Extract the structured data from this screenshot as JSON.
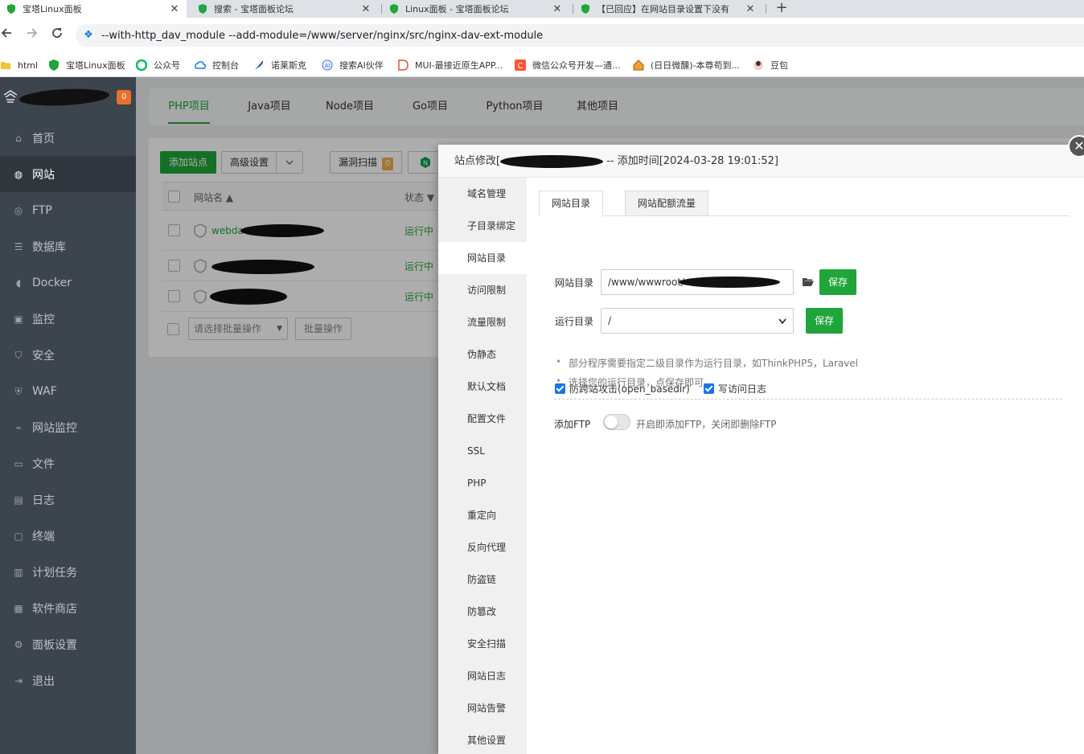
{
  "browser": {
    "tabs": [
      {
        "title": "宝塔Linux面板"
      },
      {
        "title": "搜索 - 宝塔面板论坛"
      },
      {
        "title": "Linux面板 - 宝塔面板论坛"
      },
      {
        "title": "【已回应】在网站目录设置下没有"
      }
    ],
    "close_glyph": "✕",
    "new_tab_glyph": "+",
    "url": "--with-http_dav_module --add-module=/www/server/nginx/src/nginx-dav-ext-module",
    "bookmarks": [
      {
        "label": "html",
        "icon": "folder-icon"
      },
      {
        "label": "宝塔Linux面板",
        "icon": "baota-icon"
      },
      {
        "label": "公众号",
        "icon": "wechat-icon"
      },
      {
        "label": "控制台",
        "icon": "cloud-icon"
      },
      {
        "label": "诺莱斯克",
        "icon": "feather-icon"
      },
      {
        "label": "搜索AI伙伴",
        "icon": "ai-icon"
      },
      {
        "label": "MUI-最接近原生APP...",
        "icon": "mui-icon"
      },
      {
        "label": "微信公众号开发—通...",
        "icon": "csdn-icon"
      },
      {
        "label": "(日日微醺)-本尊苟到...",
        "icon": "house-icon"
      },
      {
        "label": "豆包",
        "icon": "doubao-icon"
      }
    ]
  },
  "sidebar": {
    "version_badge": "0",
    "items": [
      {
        "label": "首页",
        "icon": "home-icon"
      },
      {
        "label": "网站",
        "icon": "globe-icon"
      },
      {
        "label": "FTP",
        "icon": "ftp-icon"
      },
      {
        "label": "数据库",
        "icon": "database-icon"
      },
      {
        "label": "Docker",
        "icon": "docker-icon"
      },
      {
        "label": "监控",
        "icon": "monitor-icon"
      },
      {
        "label": "安全",
        "icon": "shield-icon"
      },
      {
        "label": "WAF",
        "icon": "waf-icon"
      },
      {
        "label": "网站监控",
        "icon": "chart-icon"
      },
      {
        "label": "文件",
        "icon": "folder-icon"
      },
      {
        "label": "日志",
        "icon": "log-icon"
      },
      {
        "label": "终端",
        "icon": "terminal-icon"
      },
      {
        "label": "计划任务",
        "icon": "task-icon"
      },
      {
        "label": "软件商店",
        "icon": "store-icon"
      },
      {
        "label": "面板设置",
        "icon": "settings-icon"
      },
      {
        "label": "退出",
        "icon": "logout-icon"
      }
    ]
  },
  "project_tabs": [
    "PHP项目",
    "Java项目",
    "Node项目",
    "Go项目",
    "Python项目",
    "其他项目"
  ],
  "toolbar": {
    "add_site": "添加站点",
    "advanced": "高级设置",
    "vuln_scan": "漏洞扫描",
    "vuln_count": "0"
  },
  "table": {
    "col_name": "网站名",
    "col_status": "状态",
    "rows": [
      {
        "name": "webda",
        "status": "运行中"
      },
      {
        "name": "",
        "status": "运行中"
      },
      {
        "name": "",
        "status": "运行中"
      }
    ],
    "batch_placeholder": "请选择批量操作",
    "batch_button": "批量操作"
  },
  "modal": {
    "title_prefix": "站点修改[",
    "title_suffix": "-- 添加时间[2024-03-28 19:01:52]",
    "close_glyph": "✕",
    "menu": [
      "域名管理",
      "子目录绑定",
      "网站目录",
      "访问限制",
      "流量限制",
      "伪静态",
      "默认文档",
      "配置文件",
      "SSL",
      "PHP",
      "重定向",
      "反向代理",
      "防盗链",
      "防篡改",
      "安全扫描",
      "网站日志",
      "网站告警",
      "其他设置"
    ],
    "subtabs": [
      "网站目录",
      "网站配额流量"
    ],
    "checks": [
      "防跨站攻击(open_basedir)",
      "写访问日志"
    ],
    "site_dir_label": "网站目录",
    "site_dir_value": "/www/wwwroot/",
    "save": "保存",
    "run_dir_label": "运行目录",
    "run_dir_value": "/",
    "tips": [
      "部分程序需要指定二级目录作为运行目录，如ThinkPHP5，Laravel",
      "选择您的运行目录，点保存即可"
    ],
    "ftp_label": "添加FTP",
    "ftp_desc": "开启即添加FTP，关闭即删除FTP"
  },
  "colors": {
    "accent": "#20a53a",
    "sidebar": "#3c444d"
  }
}
